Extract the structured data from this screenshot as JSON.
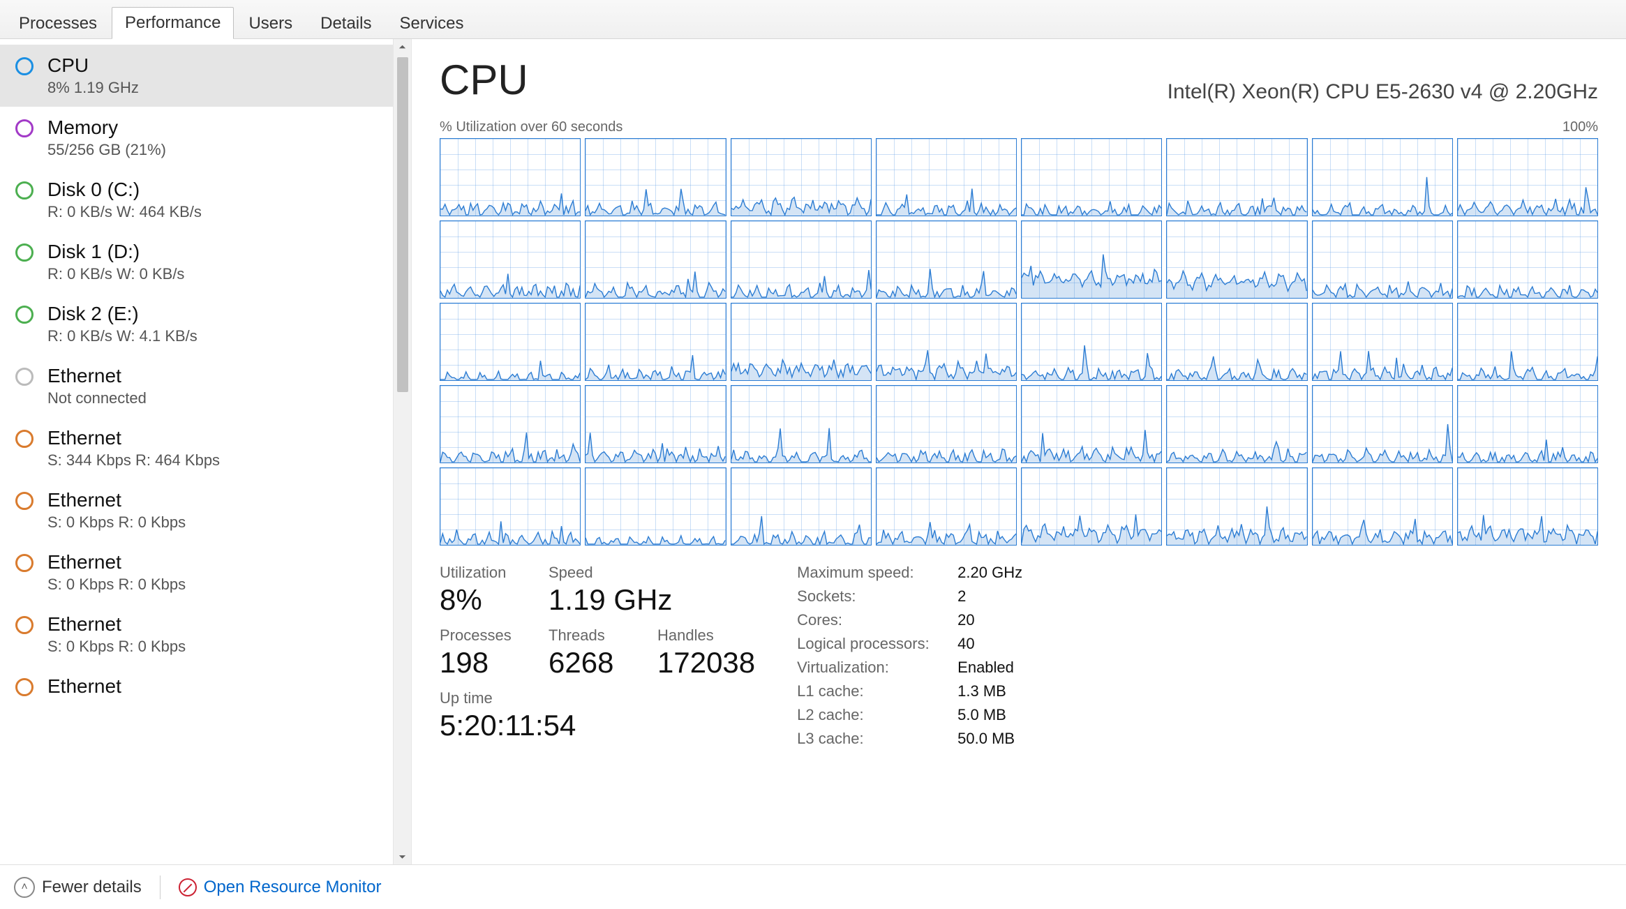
{
  "tabs": [
    "Processes",
    "Performance",
    "Users",
    "Details",
    "Services"
  ],
  "active_tab_index": 1,
  "sidebar": {
    "items": [
      {
        "title": "CPU",
        "sub": "8%  1.19 GHz",
        "ring": "#1a8fe3",
        "selected": true
      },
      {
        "title": "Memory",
        "sub": "55/256 GB (21%)",
        "ring": "#a23ac7"
      },
      {
        "title": "Disk 0 (C:)",
        "sub": "R: 0 KB/s W: 464 KB/s",
        "ring": "#4caf50"
      },
      {
        "title": "Disk 1 (D:)",
        "sub": "R: 0 KB/s W: 0 KB/s",
        "ring": "#4caf50"
      },
      {
        "title": "Disk 2 (E:)",
        "sub": "R: 0 KB/s W: 4.1 KB/s",
        "ring": "#4caf50"
      },
      {
        "title": "Ethernet",
        "sub": "Not connected",
        "ring": "#bbbbbb"
      },
      {
        "title": "Ethernet",
        "sub": "S: 344 Kbps R: 464 Kbps",
        "ring": "#d97b2e"
      },
      {
        "title": "Ethernet",
        "sub": "S: 0 Kbps R: 0 Kbps",
        "ring": "#d97b2e"
      },
      {
        "title": "Ethernet",
        "sub": "S: 0 Kbps R: 0 Kbps",
        "ring": "#d97b2e"
      },
      {
        "title": "Ethernet",
        "sub": "S: 0 Kbps R: 0 Kbps",
        "ring": "#d97b2e"
      },
      {
        "title": "Ethernet",
        "sub": "",
        "ring": "#d97b2e"
      }
    ]
  },
  "cpu": {
    "title": "CPU",
    "model": "Intel(R) Xeon(R) CPU E5-2630 v4 @ 2.20GHz",
    "chart_left_label": "% Utilization over 60 seconds",
    "chart_right_label": "100%",
    "stats_left": [
      [
        {
          "label": "Utilization",
          "value": "8%"
        },
        {
          "label": "Speed",
          "value": "1.19 GHz"
        }
      ],
      [
        {
          "label": "Processes",
          "value": "198"
        },
        {
          "label": "Threads",
          "value": "6268"
        },
        {
          "label": "Handles",
          "value": "172038"
        }
      ],
      [
        {
          "label": "Up time",
          "value": "5:20:11:54"
        }
      ]
    ],
    "stats_right": [
      {
        "k": "Maximum speed:",
        "v": "2.20 GHz"
      },
      {
        "k": "Sockets:",
        "v": "2"
      },
      {
        "k": "Cores:",
        "v": "20"
      },
      {
        "k": "Logical processors:",
        "v": "40"
      },
      {
        "k": "Virtualization:",
        "v": "Enabled"
      },
      {
        "k": "L1 cache:",
        "v": "1.3 MB"
      },
      {
        "k": "L2 cache:",
        "v": "5.0 MB"
      },
      {
        "k": "L3 cache:",
        "v": "50.0 MB"
      }
    ]
  },
  "footer": {
    "fewer": "Fewer details",
    "orm": "Open Resource Monitor"
  },
  "chart_data": {
    "type": "line",
    "title": "% Utilization over 60 seconds",
    "xlabel": "seconds",
    "ylabel": "% utilization",
    "ylim": [
      0,
      100
    ],
    "xrange_seconds": 60,
    "series_count": 40,
    "note": "Each of the 40 logical processors shows low utilization (~5-20%) with occasional spikes; values estimated from mini-charts.",
    "series_avg_pct": [
      8,
      7,
      12,
      6,
      5,
      6,
      5,
      9,
      8,
      7,
      6,
      6,
      25,
      22,
      8,
      6,
      7,
      6,
      14,
      12,
      7,
      6,
      8,
      6,
      7,
      8,
      6,
      7,
      10,
      6,
      7,
      5,
      6,
      7,
      6,
      8,
      15,
      12,
      10,
      14
    ]
  }
}
